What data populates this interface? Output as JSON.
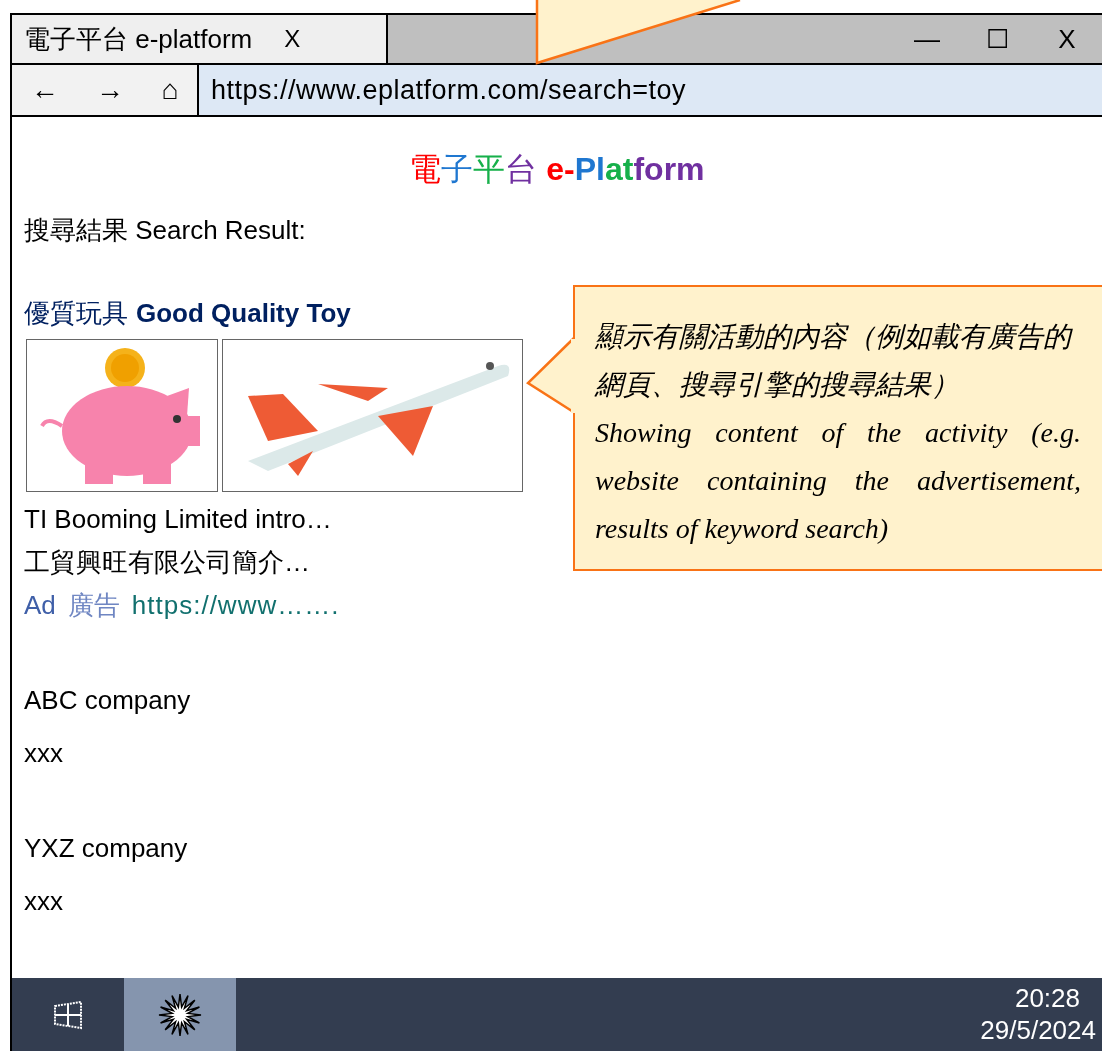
{
  "window": {
    "tab_title": "電子平台 e-platform",
    "tab_close": "X",
    "minimize": "—",
    "maximize": "☐",
    "close": "X"
  },
  "address_bar": {
    "back": "←",
    "forward": "→",
    "home": "⌂",
    "url": "https://www.eplatform.com/search=toy"
  },
  "page": {
    "logo": [
      {
        "text": "電",
        "color": "#ff0000"
      },
      {
        "text": "子",
        "color": "#1f77d0"
      },
      {
        "text": "平",
        "color": "#16b04a"
      },
      {
        "text": "台",
        "color": "#7030a0"
      },
      {
        "text": " e-",
        "color": "#ff0000"
      },
      {
        "text": "Pl",
        "color": "#1f77d0"
      },
      {
        "text": "at",
        "color": "#16b04a"
      },
      {
        "text": "form",
        "color": "#7030a0"
      }
    ],
    "heading": "搜尋結果 Search Result:",
    "ad": {
      "title_zh": "優質玩具",
      "title_en": "Good Quality Toy",
      "line_en": "TI Booming Limited intro…",
      "line_zh": "工貿興旺有限公司簡介…",
      "label_en": "Ad",
      "label_zh": "廣告",
      "url": "https://www……."
    },
    "results": [
      {
        "name": "ABC company",
        "text": "xxx"
      },
      {
        "name": "YXZ company",
        "text": "xxx"
      }
    ]
  },
  "callout": {
    "text_zh": "顯示有關活動的內容（例如載有廣告的網頁、搜尋引擎的搜尋結果）",
    "text_en": "Showing content of the activity (e.g. website containing the advertisement, results of keyword search)"
  },
  "taskbar": {
    "time": "20:28",
    "date": "29/5/2024"
  }
}
